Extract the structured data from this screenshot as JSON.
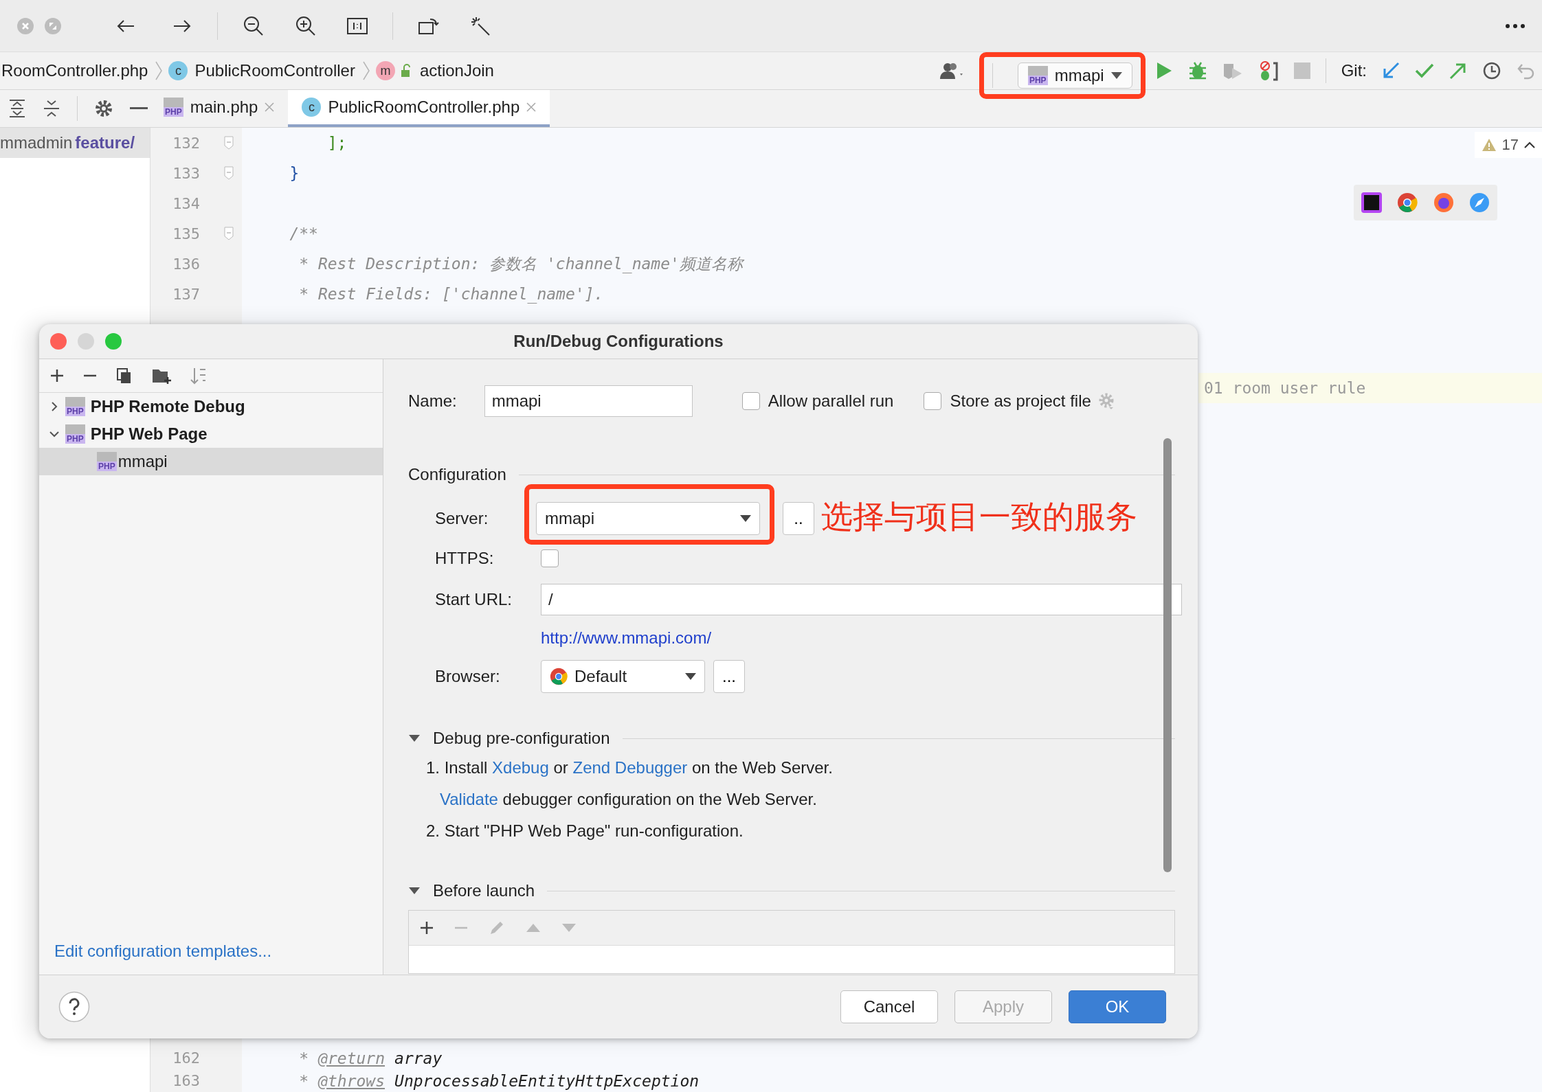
{
  "breadcrumb": [
    {
      "label": "RoomController.php",
      "kind": "file"
    },
    {
      "label": "PublicRoomController",
      "kind": "class",
      "badge": "c"
    },
    {
      "label": "actionJoin",
      "kind": "method",
      "badge": "m"
    }
  ],
  "run_config": {
    "label": "mmapi",
    "badge": "PHP"
  },
  "git_label": "Git:",
  "project_panel": {
    "path": "mmadmin",
    "branch": "feature/"
  },
  "tabs": [
    {
      "label": "main.php",
      "kind": "php",
      "badge": "PHP",
      "selected": false
    },
    {
      "label": "PublicRoomController.php",
      "kind": "class",
      "badge": "c",
      "selected": true
    }
  ],
  "editor": {
    "warning_count": "17",
    "lines": [
      {
        "number": "132",
        "fold": true,
        "segments": [
          {
            "text": "        ];",
            "kind": "bracket"
          }
        ]
      },
      {
        "number": "133",
        "fold": true,
        "segments": [
          {
            "text": "    }",
            "kind": "brace"
          }
        ]
      },
      {
        "number": "134",
        "fold": false
      },
      {
        "number": "135",
        "fold": true,
        "segments": [
          {
            "text": "    /**",
            "kind": "comment"
          }
        ]
      },
      {
        "number": "136",
        "fold": false,
        "segments": [
          {
            "text": "     * Rest Description: 参数名 'channel_name'频道名称",
            "kind": "comment"
          }
        ]
      },
      {
        "number": "137",
        "fold": false,
        "segments": [
          {
            "text": "     * Rest Fields: ['channel_name'].",
            "kind": "comment"
          }
        ]
      }
    ],
    "side_line": "01 room user rule",
    "bottom_lines": [
      {
        "number": "162",
        "fold": false,
        "segments": [
          {
            "text": "     *",
            "kind": "comment"
          },
          {
            "text": "@return",
            "kind": "tag"
          },
          {
            "text": "array",
            "kind": "type"
          }
        ]
      },
      {
        "number": "163",
        "fold": false,
        "segments": [
          {
            "text": "     *",
            "kind": "comment"
          },
          {
            "text": "@throws",
            "kind": "tag"
          },
          {
            "text": "UnprocessableEntityHttpException",
            "kind": "type"
          }
        ]
      }
    ]
  },
  "dialog": {
    "title": "Run/Debug Configurations",
    "tree": [
      {
        "label": "PHP Remote Debug",
        "badge": "PHP",
        "expanded": false
      },
      {
        "label": "PHP Web Page",
        "badge": "PHP",
        "expanded": true,
        "children": [
          {
            "label": "mmapi",
            "badge": "PHP",
            "selected": true
          }
        ]
      }
    ],
    "templates_link": "Edit configuration templates...",
    "name_label": "Name:",
    "name_value": "mmapi",
    "options": [
      {
        "label": "Allow parallel run",
        "checked": false
      },
      {
        "label": "Store as project file",
        "checked": false
      }
    ],
    "configuration_heading": "Configuration",
    "server_label": "Server:",
    "server_value": "mmapi",
    "server_more": "..",
    "https_label": "HTTPS:",
    "https_checked": false,
    "start_url_label": "Start URL:",
    "start_url_value": "/",
    "url_link": "http://www.mmapi.com/",
    "browser_label": "Browser:",
    "browser_value": "Default",
    "browser_more": "...",
    "debug_section": {
      "title": "Debug pre-configuration",
      "expanded": true,
      "steps": [
        [
          {
            "text": "1. Install ",
            "kind": "text"
          },
          {
            "text": "Xdebug",
            "kind": "link"
          },
          {
            "text": " or ",
            "kind": "text"
          },
          {
            "text": "Zend Debugger",
            "kind": "link"
          },
          {
            "text": " on the Web Server.",
            "kind": "text"
          }
        ],
        [
          {
            "text": "Validate",
            "kind": "link"
          },
          {
            "text": " debugger configuration on the Web Server.",
            "kind": "text"
          }
        ],
        [
          {
            "text": "2. Start \"PHP Web Page\" run-configuration.",
            "kind": "text"
          }
        ]
      ]
    },
    "before_launch": {
      "title": "Before launch",
      "expanded": true
    },
    "buttons": [
      {
        "label": "Cancel",
        "kind": "default",
        "disabled": false
      },
      {
        "label": "Apply",
        "kind": "default",
        "disabled": true
      },
      {
        "label": "OK",
        "kind": "primary",
        "disabled": false
      }
    ]
  },
  "annotation": {
    "text": "选择与项目一致的服务"
  }
}
